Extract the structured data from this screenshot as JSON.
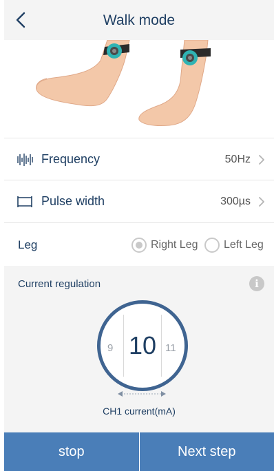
{
  "header": {
    "title": "Walk mode",
    "back_icon": "chevron-left-icon"
  },
  "hero": {
    "description_icon": "feet-with-electrodes-illustration"
  },
  "settings": {
    "frequency": {
      "label": "Frequency",
      "value": "50Hz",
      "icon": "waveform-icon"
    },
    "pulse_width": {
      "label": "Pulse width",
      "value": "300µs",
      "icon": "width-bracket-icon"
    },
    "leg": {
      "label": "Leg",
      "options": [
        {
          "label": "Right Leg",
          "selected": true
        },
        {
          "label": "Left Leg",
          "selected": false
        }
      ]
    }
  },
  "regulation": {
    "title": "Current regulation",
    "info_icon": "info-icon",
    "info_glyph": "i",
    "current_value": "10",
    "prev_value": "9",
    "next_value": "11",
    "caption": "CH1 current(mA)"
  },
  "buttons": {
    "stop": "stop",
    "next": "Next step"
  },
  "colors": {
    "primary": "#4a7eb8",
    "title_text": "#1f3f63",
    "dial_ring": "#3f6491",
    "panel_bg": "#f4f4f4",
    "electrode": "#2fb3b3"
  }
}
